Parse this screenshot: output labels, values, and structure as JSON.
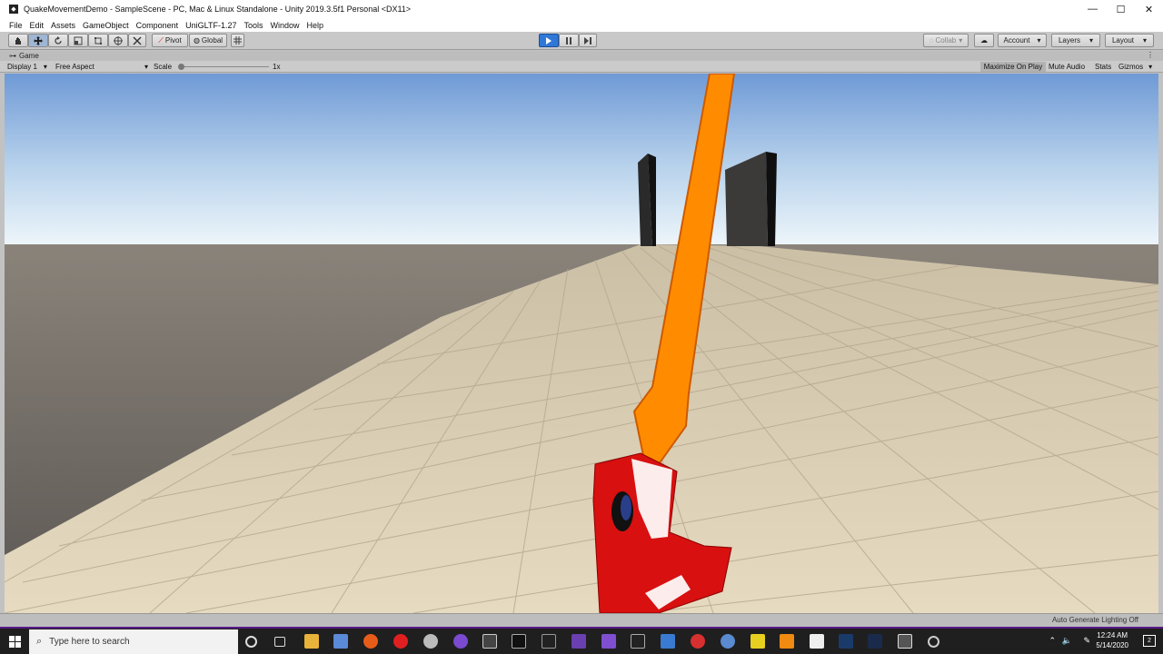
{
  "window": {
    "title": "QuakeMovementDemo - SampleScene - PC, Mac & Linux Standalone - Unity 2019.3.5f1 Personal <DX11>",
    "controls": [
      "—",
      "☐",
      "✕"
    ]
  },
  "menu": [
    "File",
    "Edit",
    "Assets",
    "GameObject",
    "Component",
    "UniGLTF-1.27",
    "Tools",
    "Window",
    "Help"
  ],
  "toolbar": {
    "tools": [
      "hand-tool",
      "move-tool",
      "rotate-tool",
      "scale-tool",
      "rect-tool",
      "transform-tool",
      "custom-tool"
    ],
    "pivot_label": "Pivot",
    "global_label": "Global",
    "play_state": "playing",
    "collab_label": "Collab",
    "account_label": "Account",
    "layers_label": "Layers",
    "layout_label": "Layout"
  },
  "game_tab": {
    "label": "Game",
    "display_label": "Display 1",
    "aspect_label": "Free Aspect",
    "scale_label": "Scale",
    "scale_value": "1x",
    "maximize_label": "Maximize On Play",
    "mute_label": "Mute Audio",
    "stats_label": "Stats",
    "gizmos_label": "Gizmos"
  },
  "status": {
    "lighting": "Auto Generate Lighting Off"
  },
  "taskbar": {
    "search_placeholder": "Type here to search",
    "time": "12:24 AM",
    "date": "5/14/2020",
    "notification_count": "2"
  },
  "colors": {
    "sky_top": "#7fa8dc",
    "sky_horizon": "#e8f2f8",
    "floor": "#d8cbb0",
    "weapon_orange": "#ff8a00",
    "weapon_red": "#d81010",
    "play_blue": "#2f78d8"
  }
}
